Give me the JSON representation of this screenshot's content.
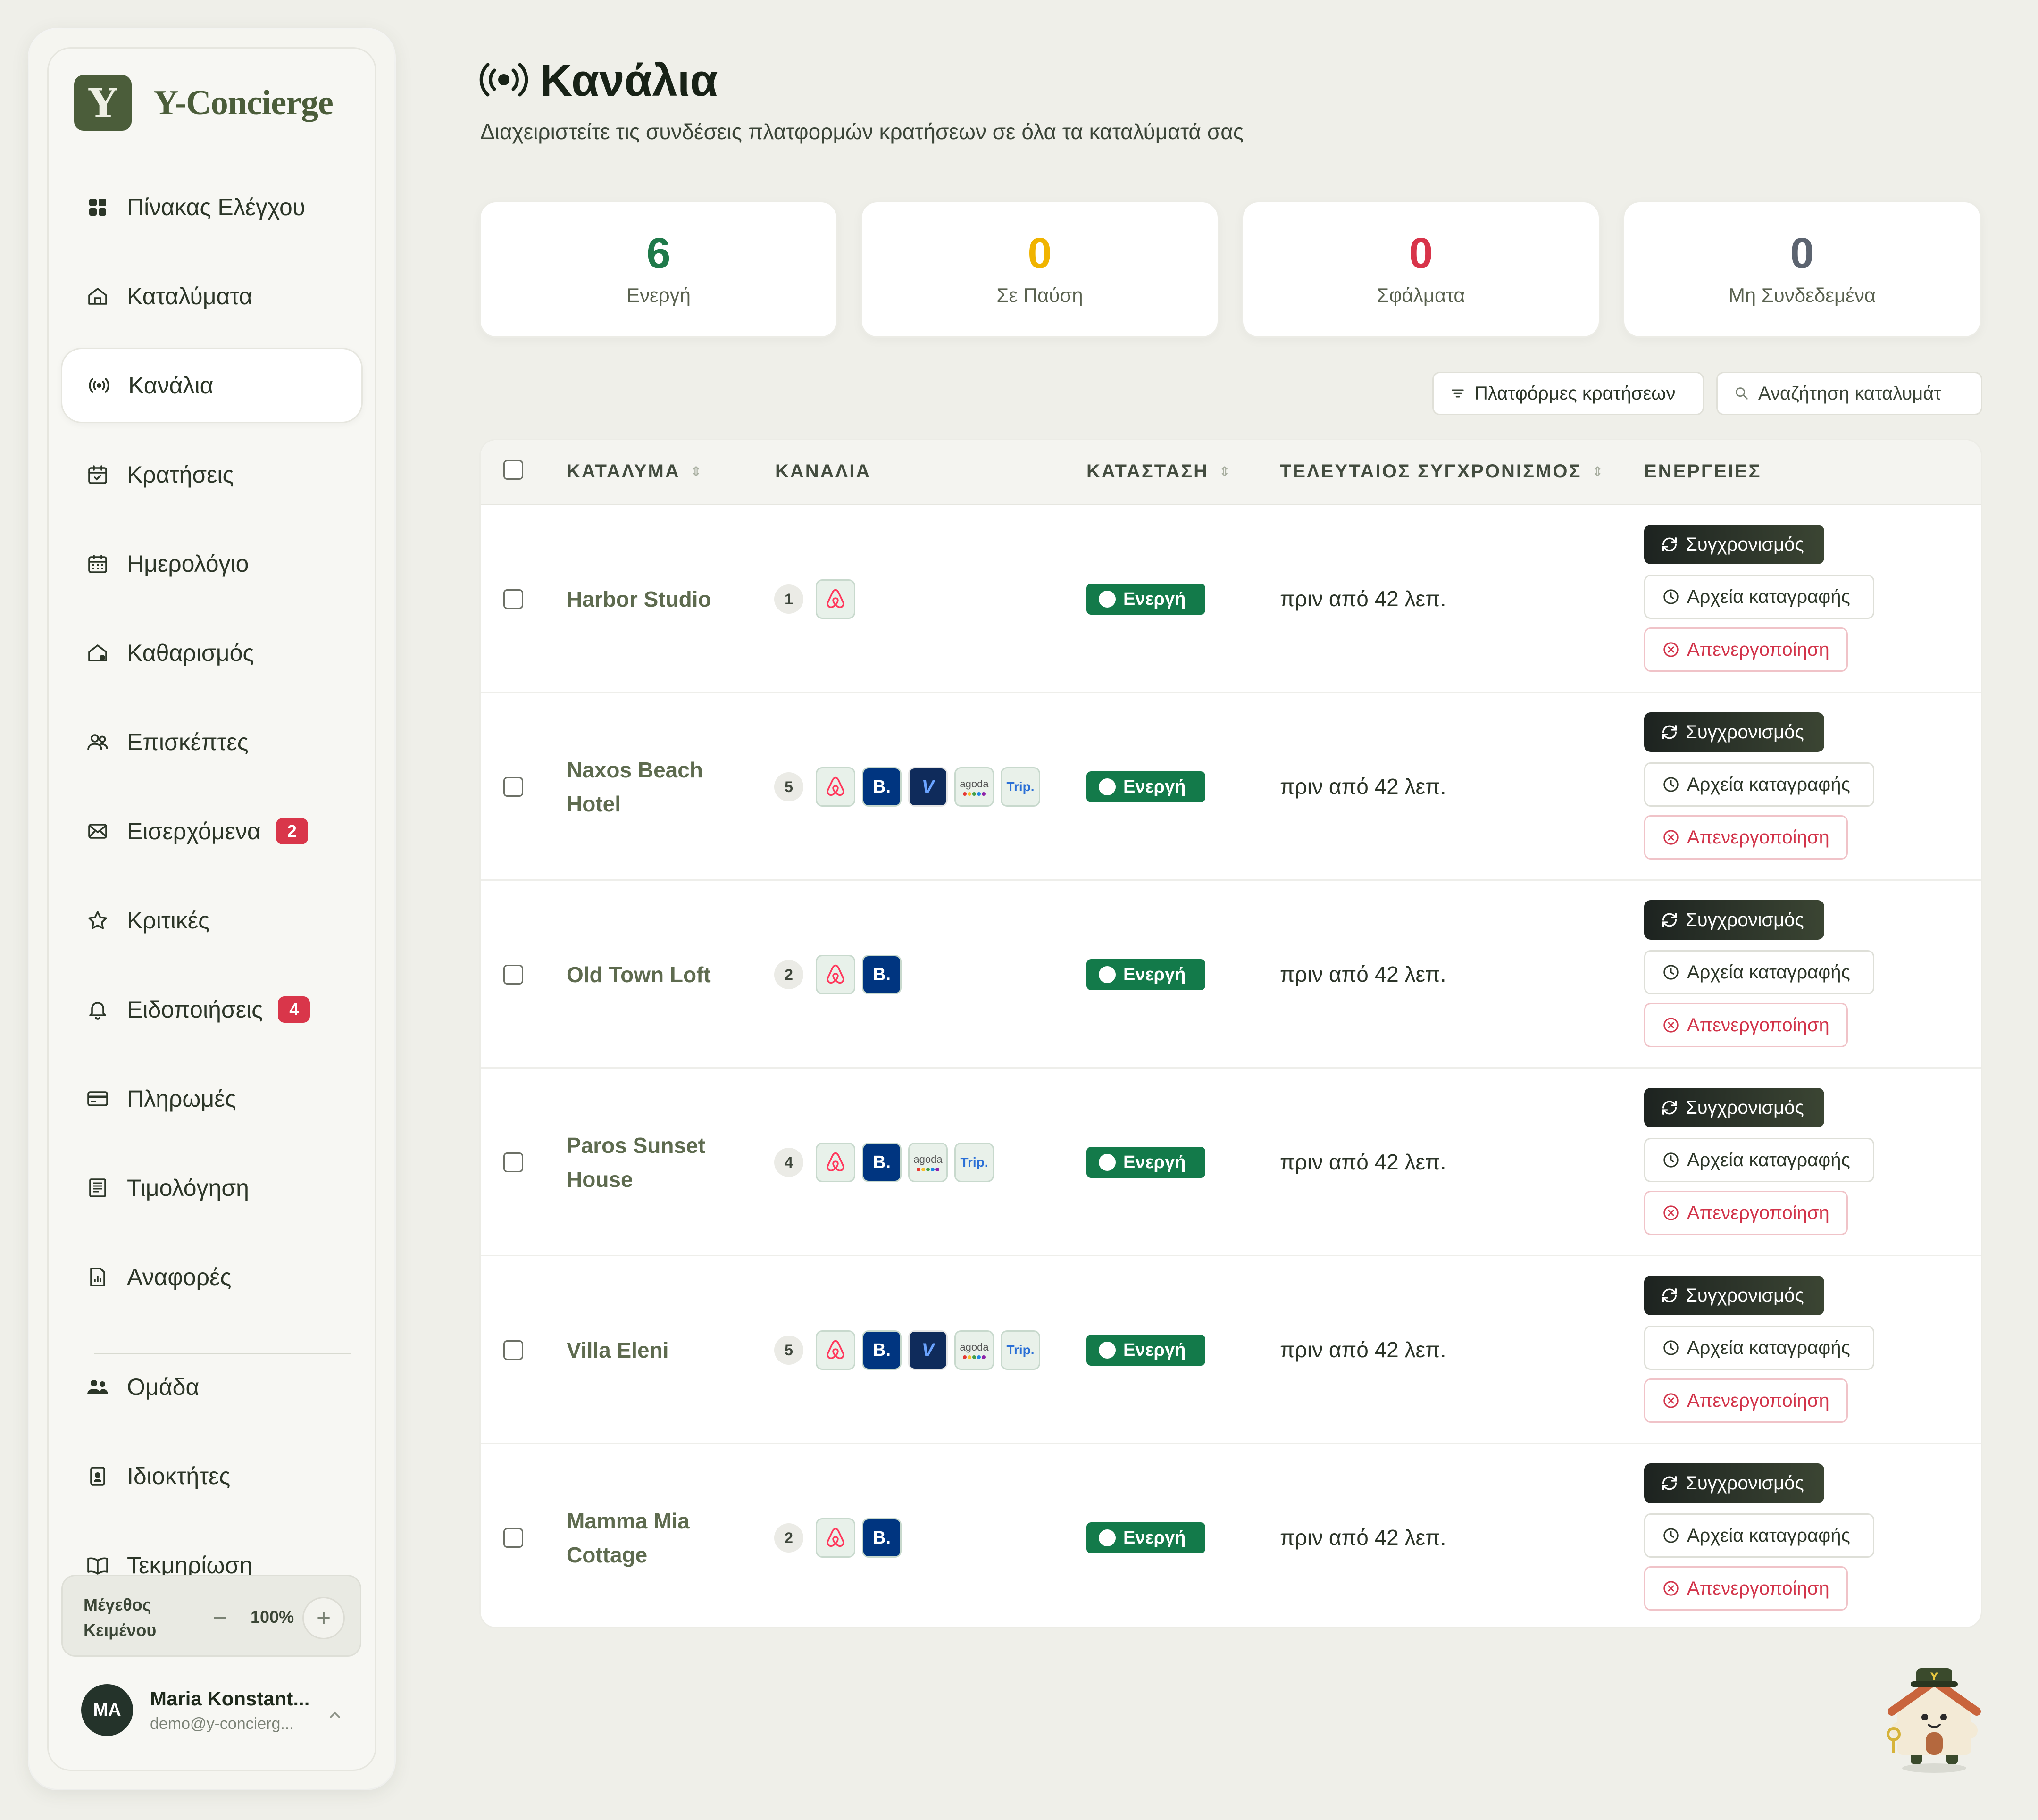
{
  "app": {
    "brand_letter": "Y",
    "brand_name": "Y-Concierge"
  },
  "sidebar": {
    "items": [
      {
        "label": "Πίνακας Ελέγχου",
        "icon": "grid-icon"
      },
      {
        "label": "Καταλύματα",
        "icon": "home-icon"
      },
      {
        "label": "Κανάλια",
        "icon": "broadcast-icon",
        "active": true
      },
      {
        "label": "Κρατήσεις",
        "icon": "calendar-check-icon"
      },
      {
        "label": "Ημερολόγιο",
        "icon": "calendar-icon"
      },
      {
        "label": "Καθαρισμός",
        "icon": "clean-house-icon"
      },
      {
        "label": "Επισκέπτες",
        "icon": "users-icon"
      },
      {
        "label": "Εισερχόμενα",
        "icon": "mail-icon",
        "badge": "2"
      },
      {
        "label": "Κριτικές",
        "icon": "star-icon"
      },
      {
        "label": "Ειδοποιήσεις",
        "icon": "bell-icon",
        "badge": "4"
      },
      {
        "label": "Πληρωμές",
        "icon": "credit-card-icon"
      },
      {
        "label": "Τιμολόγηση",
        "icon": "invoice-icon"
      },
      {
        "label": "Αναφορές",
        "icon": "report-icon"
      }
    ],
    "secondary_items": [
      {
        "label": "Ομάδα",
        "icon": "team-icon"
      },
      {
        "label": "Ιδιοκτήτες",
        "icon": "owner-badge-icon"
      },
      {
        "label": "Τεκμηρίωση",
        "icon": "book-icon"
      }
    ],
    "text_size": {
      "label": "Μέγεθος Κειμένου",
      "value": "100%",
      "minus": "−",
      "plus": "+"
    },
    "user": {
      "initials": "MA",
      "name": "Maria Konstant...",
      "email": "demo@y-concierg..."
    }
  },
  "header": {
    "title": "Κανάλια",
    "subtitle": "Διαχειριστείτε τις συνδέσεις πλατφορμών κρατήσεων σε όλα τα καταλύματά σας"
  },
  "stats": [
    {
      "value": "6",
      "label": "Ενεργή",
      "color": "#1f7a4a"
    },
    {
      "value": "0",
      "label": "Σε Παύση",
      "color": "#f0b400"
    },
    {
      "value": "0",
      "label": "Σφάλματα",
      "color": "#d8344a"
    },
    {
      "value": "0",
      "label": "Μη Συνδεδεμένα",
      "color": "#5c6470"
    }
  ],
  "toolbar": {
    "filter_label": "Πλατφόρμες κρατήσεων",
    "search_placeholder": "Αναζήτηση καταλυμάτ"
  },
  "table": {
    "columns": [
      "ΚΑΤΑΛΥΜΑ",
      "ΚΑΝΑΛΙΑ",
      "ΚΑΤΑΣΤΑΣΗ",
      "ΤΕΛΕΥΤΑΙΟΣ ΣΥΓΧΡΟΝΙΣΜΟΣ",
      "ΕΝΕΡΓΕΙΕΣ"
    ],
    "actions": {
      "sync": "Συγχρονισμός",
      "logs": "Αρχεία καταγραφής",
      "deactivate": "Απενεργοποίηση"
    },
    "rows": [
      {
        "name_lines": [
          "Harbor Studio"
        ],
        "count": "1",
        "channels": [
          "airbnb"
        ],
        "status": "Ενεργή",
        "last_sync": "πριν από 42 λεπ."
      },
      {
        "name_lines": [
          "Naxos Beach",
          "Hotel"
        ],
        "count": "5",
        "channels": [
          "airbnb",
          "booking",
          "vrbo",
          "agoda",
          "trip"
        ],
        "status": "Ενεργή",
        "last_sync": "πριν από 42 λεπ."
      },
      {
        "name_lines": [
          "Old Town Loft"
        ],
        "count": "2",
        "channels": [
          "airbnb",
          "booking"
        ],
        "status": "Ενεργή",
        "last_sync": "πριν από 42 λεπ."
      },
      {
        "name_lines": [
          "Paros Sunset",
          "House"
        ],
        "count": "4",
        "channels": [
          "airbnb",
          "booking",
          "agoda",
          "trip"
        ],
        "status": "Ενεργή",
        "last_sync": "πριν από 42 λεπ."
      },
      {
        "name_lines": [
          "Villa Eleni"
        ],
        "count": "5",
        "channels": [
          "airbnb",
          "booking",
          "vrbo",
          "agoda",
          "trip"
        ],
        "status": "Ενεργή",
        "last_sync": "πριν από 42 λεπ."
      },
      {
        "name_lines": [
          "Mamma Mia",
          "Cottage"
        ],
        "count": "2",
        "channels": [
          "airbnb",
          "booking"
        ],
        "status": "Ενεργή",
        "last_sync": "πριν από 42 λεπ."
      }
    ]
  },
  "channel_labels": {
    "booking": "B.",
    "vrbo": "V",
    "agoda": "agoda",
    "trip": "Trip."
  },
  "colors": {
    "accent": "#4b5d3a",
    "status_active": "#137a4a",
    "danger": "#d2344a",
    "badge": "#d9364a"
  }
}
